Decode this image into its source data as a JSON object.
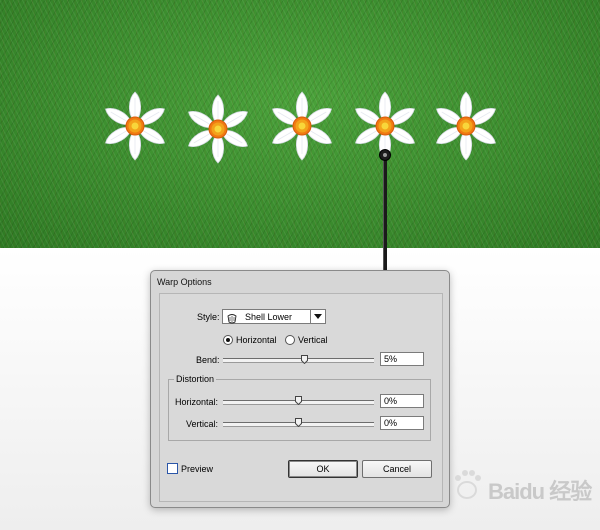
{
  "canvas": {
    "flowers": [
      {
        "name": "daffodil-1"
      },
      {
        "name": "daffodil-2"
      },
      {
        "name": "daffodil-3"
      },
      {
        "name": "daffodil-4"
      },
      {
        "name": "daffodil-5"
      }
    ]
  },
  "dialog": {
    "title": "Warp Options",
    "style_label": "Style:",
    "style_value": "Shell Lower",
    "style_icon": "shell-lower-icon",
    "orientation": {
      "horizontal_label": "Horizontal",
      "vertical_label": "Vertical",
      "selected": "Horizontal"
    },
    "bend": {
      "label": "Bend:",
      "value": "5%",
      "slider_fraction": 0.54
    },
    "distortion": {
      "group_label": "Distortion",
      "horizontal": {
        "label": "Horizontal:",
        "value": "0%",
        "slider_fraction": 0.5
      },
      "vertical": {
        "label": "Vertical:",
        "value": "0%",
        "slider_fraction": 0.5
      }
    },
    "preview": {
      "label": "Preview",
      "checked": false
    },
    "ok_label": "OK",
    "cancel_label": "Cancel"
  },
  "watermark": {
    "logo": "baidu-paw-logo",
    "text": "Baidu 经验"
  },
  "colors": {
    "grass": "#3b8d2e",
    "petal": "#ffffff",
    "flower_center": "#f07a12",
    "dialog_bg": "#d6d6d6",
    "checkbox_border": "#2b56a8"
  }
}
